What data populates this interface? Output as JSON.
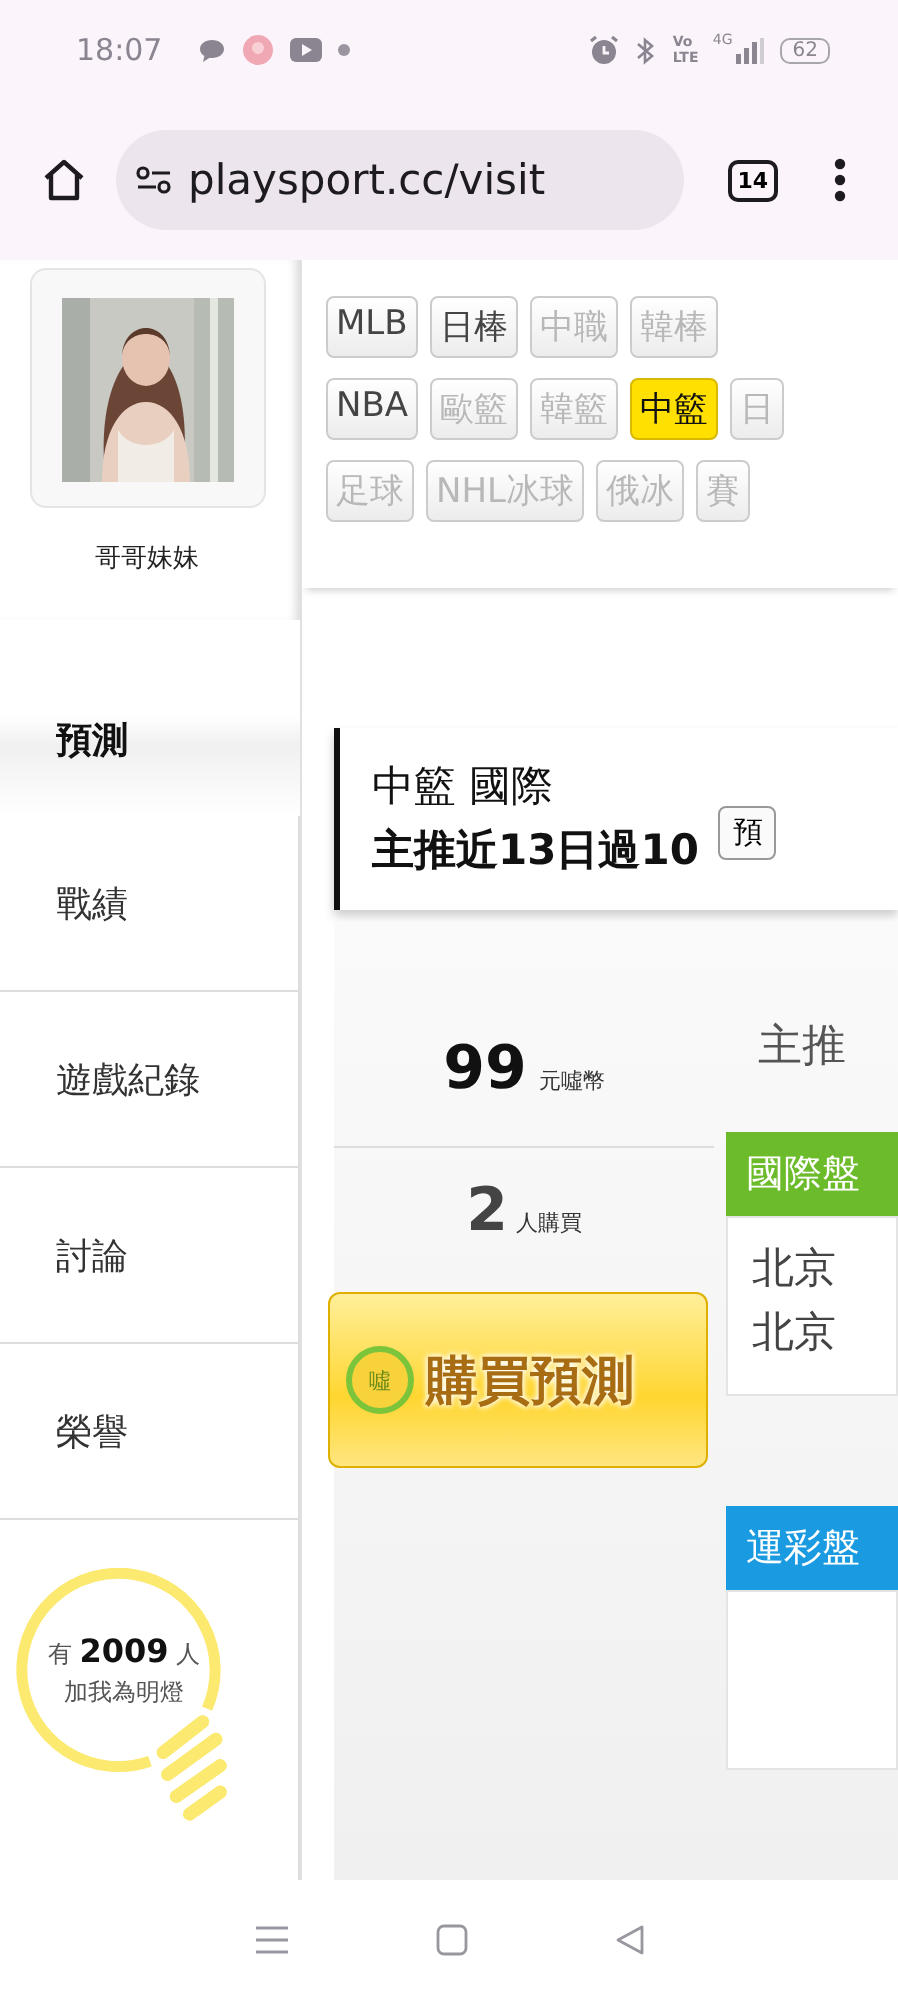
{
  "status_bar": {
    "time": "18:07",
    "volte": "Vo LTE",
    "network": "4G",
    "battery": "62"
  },
  "browser": {
    "url": "playsport.cc/visit",
    "tab_count": "14"
  },
  "profile": {
    "name": "哥哥妹妹"
  },
  "menu": [
    {
      "label": "預測",
      "selected": true
    },
    {
      "label": "戰績",
      "selected": false
    },
    {
      "label": "遊戲紀錄",
      "selected": false
    },
    {
      "label": "討論",
      "selected": false
    },
    {
      "label": "榮譽",
      "selected": false
    }
  ],
  "fans": {
    "count_line": "有 **2009** 人",
    "caption": "加我為明燈"
  },
  "tag_rows": [
    [
      {
        "label": "MLB",
        "selected": false,
        "disabled": false
      },
      {
        "label": "日棒",
        "selected": false,
        "disabled": false
      },
      {
        "label": "中職",
        "selected": false,
        "disabled": true
      },
      {
        "label": "韓棒",
        "selected": false,
        "disabled": true
      }
    ],
    [
      {
        "label": "NBA",
        "selected": false,
        "disabled": false
      },
      {
        "label": "歐籃",
        "selected": false,
        "disabled": true
      },
      {
        "label": "韓籃",
        "selected": false,
        "disabled": true
      },
      {
        "label": "中籃",
        "selected": true,
        "disabled": false
      },
      {
        "label": "日",
        "selected": false,
        "disabled": true
      }
    ],
    [
      {
        "label": "足球",
        "selected": false,
        "disabled": true
      },
      {
        "label": "NHL冰球",
        "selected": false,
        "disabled": true
      },
      {
        "label": "俄冰",
        "selected": false,
        "disabled": true
      },
      {
        "label": "賽",
        "selected": false,
        "disabled": true
      }
    ]
  ],
  "heading": {
    "title": "中籃 國際",
    "subtitle": "主推近13日過10",
    "button": "預"
  },
  "offer": {
    "price": "99",
    "price_unit": "元噓幣",
    "buyers": "2",
    "buyers_unit": "人購買",
    "buy_button": {
      "badge": "噓",
      "label": "購買預測"
    }
  },
  "predictions": {
    "title": "主推",
    "sections": [
      {
        "header": "國際盤",
        "color": "#6cbb2a",
        "lines": [
          "北京",
          "北京"
        ]
      },
      {
        "header": "運彩盤",
        "color": "#1a9ae0"
      }
    ]
  }
}
